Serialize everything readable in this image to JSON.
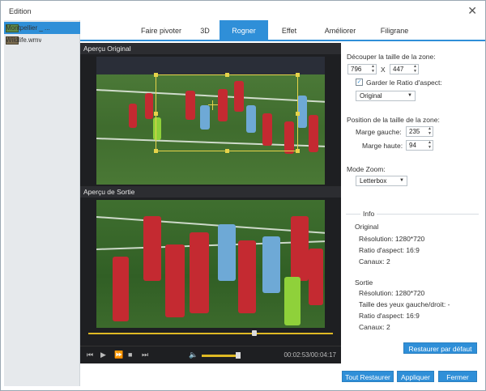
{
  "window": {
    "title": "Edition"
  },
  "files": [
    {
      "label": "Montpellier _ ...",
      "selected": true
    },
    {
      "label": "Wildlife.wmv",
      "selected": false
    }
  ],
  "tabs": [
    "Faire pivoter",
    "3D",
    "Rogner",
    "Effet",
    "Améliorer",
    "Filigrane"
  ],
  "active_tab": "Rogner",
  "preview": {
    "original_label": "Aperçu Original",
    "output_label": "Aperçu de Sortie",
    "progress": 0.68,
    "volume": 0.9,
    "time": "00:02:53/00:04:17"
  },
  "settings": {
    "crop_size_label": "Découper la taille de la zone:",
    "width": "796",
    "times": "X",
    "height": "447",
    "keep_ratio_label": "Garder le Ratio d'aspect:",
    "keep_ratio_checked": true,
    "ratio_value": "Original",
    "position_label": "Position de la taille de la zone:",
    "left_margin_label": "Marge gauche:",
    "left_margin": "235",
    "top_margin_label": "Marge haute:",
    "top_margin": "94",
    "zoom_label": "Mode Zoom:",
    "zoom_value": "Letterbox"
  },
  "info": {
    "title": "Info",
    "original_title": "Original",
    "original_resolution": "Résolution: 1280*720",
    "original_ratio": "Ratio d'aspect: 16:9",
    "original_channels": "Canaux: 2",
    "output_title": "Sortie",
    "output_resolution": "Résolution: 1280*720",
    "output_eye_size": "Taille des yeux gauche/droit: -",
    "output_ratio": "Ratio d'aspect: 16:9",
    "output_channels": "Canaux: 2"
  },
  "buttons": {
    "restore_default": "Restaurer par défaut",
    "restore_all": "Tout Restaurer",
    "apply": "Appliquer",
    "close": "Fermer"
  },
  "colors": {
    "accent": "#2f8fd8",
    "crop": "#e6d34a",
    "progress": "#e0b924"
  }
}
